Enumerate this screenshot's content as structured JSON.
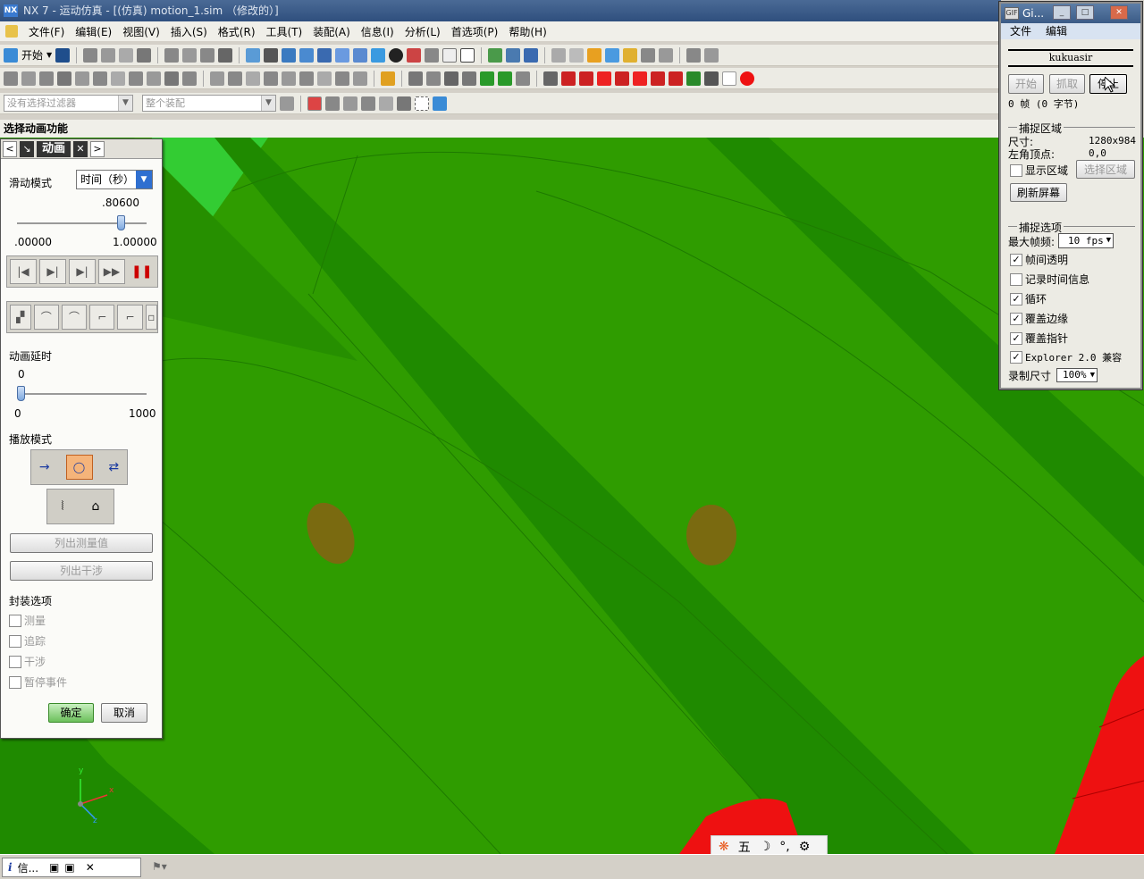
{
  "window": {
    "title": "NX 7 - 运动仿真 - [(仿真) motion_1.sim （修改的）]",
    "logo": "NX"
  },
  "menu": [
    "文件(F)",
    "编辑(E)",
    "视图(V)",
    "插入(S)",
    "格式(R)",
    "工具(T)",
    "装配(A)",
    "信息(I)",
    "分析(L)",
    "首选项(P)",
    "帮助(H)"
  ],
  "toolbar": {
    "start_label": "开始",
    "selection_filter": "没有选择过滤器",
    "assembly_scope": "整个装配"
  },
  "cue_line": "选择动画功能",
  "animation_dialog": {
    "tab_title": "动画",
    "slide_mode_label": "滑动模式",
    "slide_mode_value": "时间（秒）",
    "time_value": ".80600",
    "time_fraction": 0.806,
    "time_min": ".00000",
    "time_max": "1.00000",
    "delay_label": "动画延时",
    "delay_value": "0",
    "delay_min": "0",
    "delay_max": "1000",
    "playback_mode_label": "播放模式",
    "list_measurements": "列出测量值",
    "list_interference": "列出干涉",
    "package_options_label": "封装选项",
    "package_options": [
      "测量",
      "追踪",
      "干涉",
      "暂停事件"
    ],
    "ok": "确定",
    "cancel": "取消"
  },
  "gif_recorder": {
    "title": "Gi...",
    "menu": [
      "文件",
      "编辑"
    ],
    "user": "kukuasir",
    "buttons": [
      "开始",
      "抓取",
      "停止"
    ],
    "frame_info": "0 帧 (0 字节)",
    "capture_area_label": "捕捉区域",
    "size_label": "尺寸:",
    "size_value": "1280x984",
    "origin_label": "左角顶点:",
    "origin_value": "0,0",
    "show_area": "显示区域",
    "select_area": "选择区域",
    "refresh": "刷新屏幕",
    "capture_options_label": "捕捉选项",
    "max_fps_label": "最大帧频:",
    "max_fps_value": "10 fps",
    "options": [
      {
        "label": "帧间透明",
        "checked": true
      },
      {
        "label": "记录时间信息",
        "checked": false
      },
      {
        "label": "循环",
        "checked": true
      },
      {
        "label": "覆盖边缘",
        "checked": true
      },
      {
        "label": "覆盖指针",
        "checked": true
      },
      {
        "label": "Explorer 2.0 兼容",
        "checked": true
      }
    ],
    "record_size_label": "录制尺寸",
    "record_size_value": "100%"
  },
  "taskbar": {
    "info_label": "信..."
  },
  "ime": {
    "mode": "五"
  },
  "axes": {
    "x": "x",
    "y": "y",
    "z": "z"
  },
  "colors": {
    "model_green": "#2f9c00",
    "dark_green": "#1f8a00",
    "light_green": "#33cc33",
    "hole": "#7a6a10",
    "red_part": "#ee1111"
  }
}
